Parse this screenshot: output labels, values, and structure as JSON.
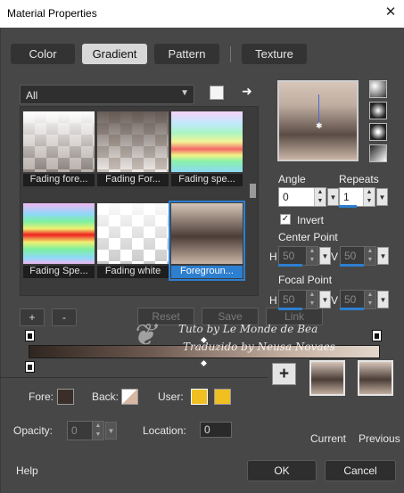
{
  "window": {
    "title": "Material Properties",
    "close": "✕"
  },
  "tabs": [
    {
      "label": "Color"
    },
    {
      "label": "Gradient"
    },
    {
      "label": "Pattern"
    },
    {
      "label": "Texture"
    }
  ],
  "gallery": {
    "filter": "All",
    "items": [
      {
        "label": "Fading fore..."
      },
      {
        "label": "Fading For..."
      },
      {
        "label": "Fading spe..."
      },
      {
        "label": "Fading Spe..."
      },
      {
        "label": "Fading white"
      },
      {
        "label": "Foregroun..."
      }
    ]
  },
  "buttons": {
    "add": "+",
    "remove": "-",
    "reset": "Reset",
    "save": "Save",
    "link": "Link",
    "ok": "OK",
    "cancel": "Cancel",
    "help": "Help",
    "plus": "+"
  },
  "style": {
    "angle_label": "Angle",
    "angle": "0",
    "repeats_label": "Repeats",
    "repeats": "1",
    "invert_label": "Invert",
    "invert_checked": true,
    "center_label": "Center Point",
    "center_h": "50",
    "center_v": "50",
    "focal_label": "Focal Point",
    "focal_h": "50",
    "focal_v": "50",
    "h": "H",
    "v": "V"
  },
  "stops": {
    "fore_label": "Fore:",
    "back_label": "Back:",
    "user_label": "User:",
    "opacity_label": "Opacity:",
    "opacity": "0",
    "location_label": "Location:",
    "location": "0"
  },
  "swatches": {
    "current": "Current",
    "previous": "Previous"
  },
  "watermark": {
    "line1": "Tuto by Le Monde de Bea",
    "line2": "Traduzido by Neusa Novaes"
  },
  "colors": {
    "accent": "#2d7fd0",
    "panel": "#474747",
    "user": "#f0c020"
  }
}
